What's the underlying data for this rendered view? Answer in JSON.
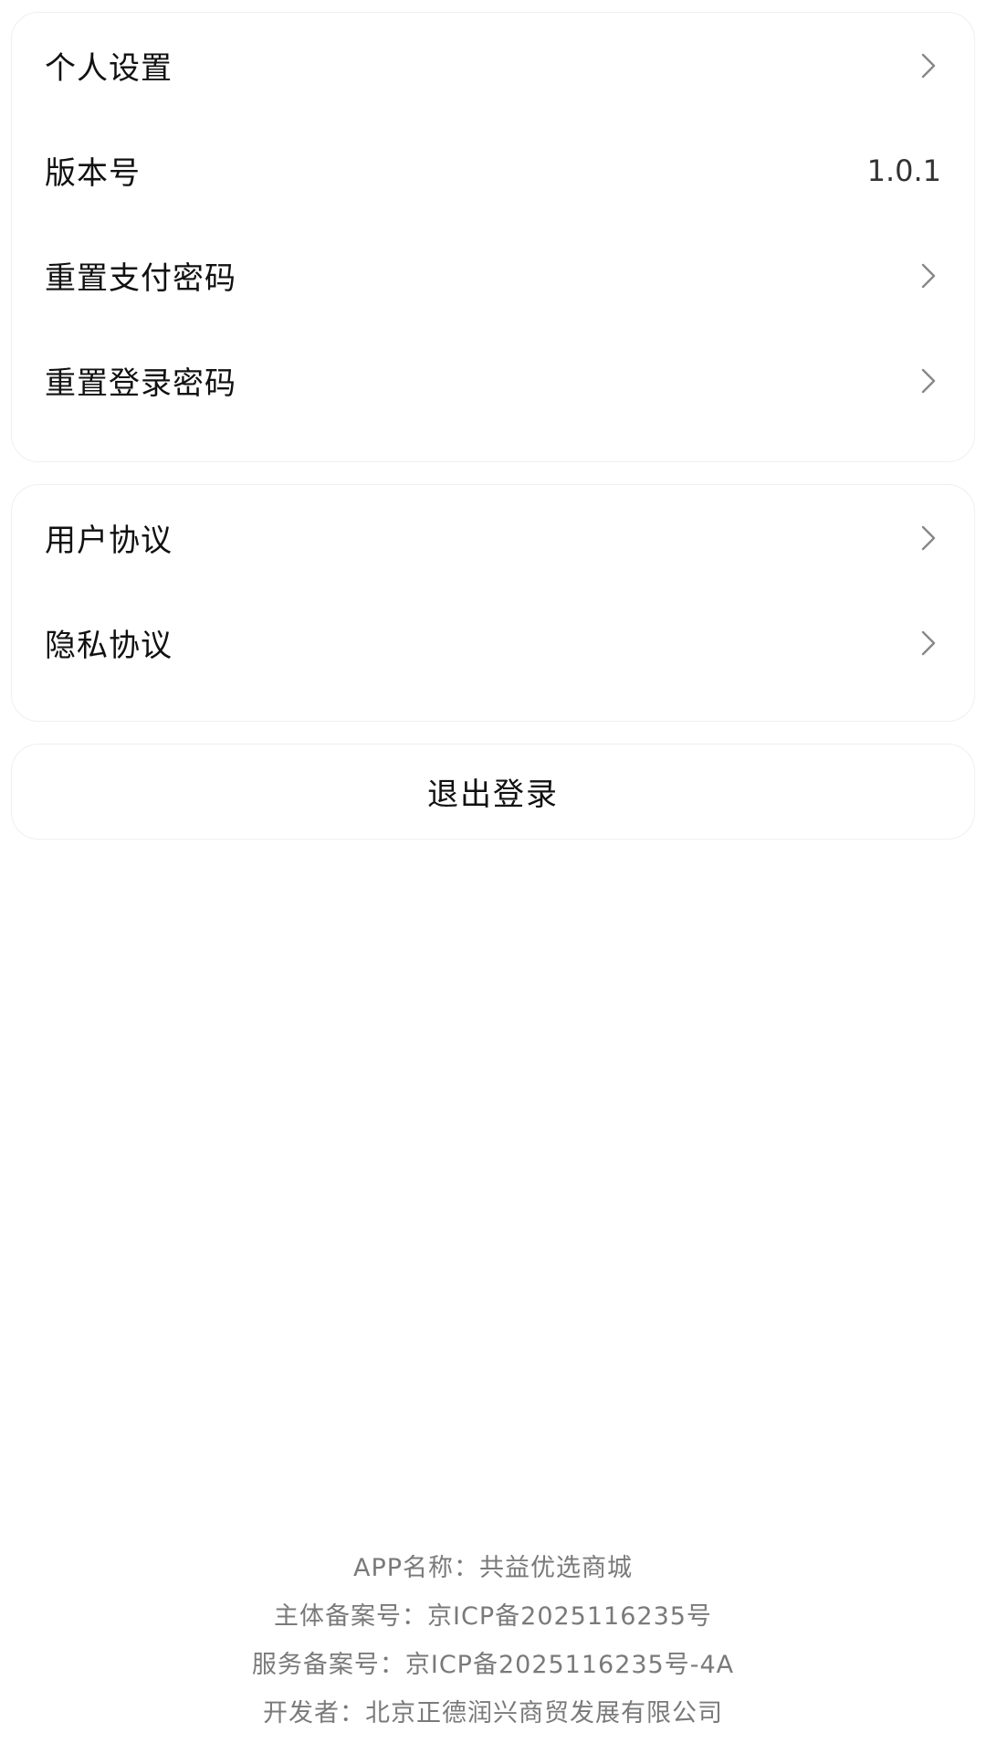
{
  "settings": {
    "items": [
      {
        "label": "个人设置"
      },
      {
        "label": "版本号",
        "value": "1.0.1"
      },
      {
        "label": "重置支付密码"
      },
      {
        "label": "重置登录密码"
      }
    ]
  },
  "legal": {
    "items": [
      {
        "label": "用户协议"
      },
      {
        "label": "隐私协议"
      }
    ]
  },
  "logout": {
    "label": "退出登录"
  },
  "footer": {
    "app_name": "APP名称：共益优选商城",
    "entity_record": "主体备案号：京ICP备2025116235号",
    "service_record": "服务备案号：京ICP备2025116235号-4A",
    "developer": "开发者：北京正德润兴商贸发展有限公司"
  },
  "colors": {
    "text_primary": "#111111",
    "text_secondary": "#333333",
    "footer_text": "#7a7a7a",
    "chevron": "#888888",
    "card_border": "#efefef",
    "background": "#ffffff"
  },
  "icons": {
    "chevron": "chevron-right-icon"
  }
}
